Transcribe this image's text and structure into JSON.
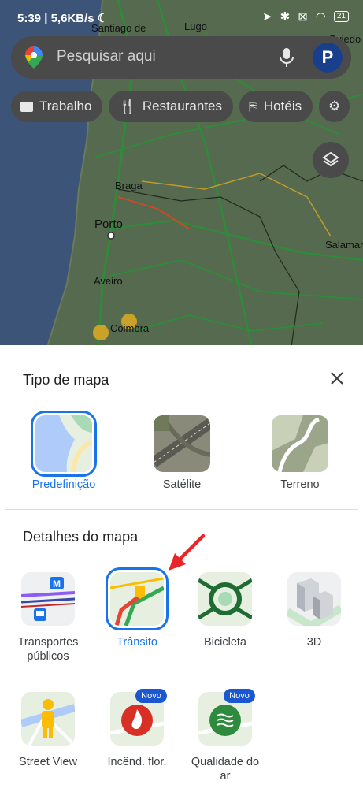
{
  "status_bar": {
    "time": "5:39",
    "speed": "| 5,6KB/s",
    "battery": "21"
  },
  "search": {
    "placeholder": "Pesquisar aqui"
  },
  "chips": [
    {
      "label": "Trabalho",
      "icon": "briefcase-icon"
    },
    {
      "label": "Restaurantes",
      "icon": "utensils-icon"
    },
    {
      "label": "Hotéis",
      "icon": "bed-icon"
    }
  ],
  "map_labels": {
    "santiago": "Santiago de",
    "lugo": "Lugo",
    "oviedo": "Oviedo",
    "braga": "Braga",
    "porto": "Porto",
    "aveiro": "Aveiro",
    "coimbra": "Coimbra",
    "salamanca": "Salaman"
  },
  "map_type": {
    "title": "Tipo de mapa",
    "options": [
      "Predefinição",
      "Satélite",
      "Terreno"
    ],
    "selected": "Predefinição"
  },
  "map_details": {
    "title": "Detalhes do mapa",
    "items": [
      [
        "Transportes",
        "públicos"
      ],
      [
        "Trânsito"
      ],
      [
        "Bicicleta"
      ],
      [
        "3D"
      ],
      [
        "Street View"
      ],
      [
        "Incênd. flor."
      ],
      [
        "Qualidade do",
        "ar"
      ]
    ],
    "selected": "Trânsito",
    "badge": "Novo"
  },
  "colors": {
    "accent": "#1a73e8",
    "badge": "#1a57d0",
    "arrow": "#e8262a"
  }
}
